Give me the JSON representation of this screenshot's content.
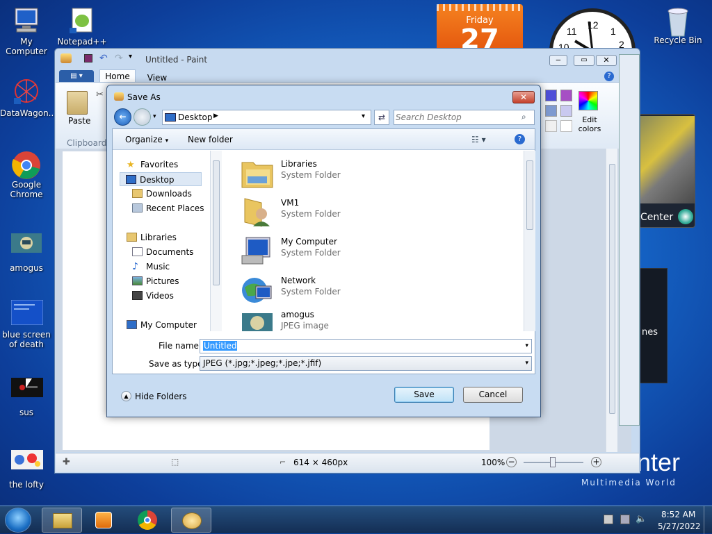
{
  "desktop": {
    "icons": [
      {
        "label": "My Computer"
      },
      {
        "label": "Notepad++"
      },
      {
        "label": "DataWagon..."
      },
      {
        "label": "Google Chrome"
      },
      {
        "label": "amogus"
      },
      {
        "label": "blue screen of death"
      },
      {
        "label": "sus"
      },
      {
        "label": "the lofty"
      },
      {
        "label": "Recycle Bin"
      }
    ],
    "gadget_calendar": {
      "day": "Friday",
      "date": "27"
    },
    "media_center": {
      "text_center": "Center",
      "brand": "nter",
      "tagline": "Multimedia World",
      "side_text": "nes"
    }
  },
  "paint": {
    "title": "Untitled - Paint",
    "tabs": [
      "Home",
      "View"
    ],
    "clipboard": {
      "paste_label": "Paste",
      "group_label": "Clipboard"
    },
    "edit_colors_label": "Edit colors",
    "status": {
      "dimensions": "614 × 460px",
      "zoom": "100%"
    },
    "colors": [
      "#4f4fd8",
      "#a64fc4",
      "#7e9ad0",
      "#c9c9f0",
      "#f0f0f0",
      "#ffffff"
    ]
  },
  "dialog": {
    "title": "Save As",
    "address": "Desktop",
    "search_placeholder": "Search Desktop",
    "toolbar": {
      "organize": "Organize",
      "new_folder": "New folder"
    },
    "nav": {
      "favorites": "Favorites",
      "desktop": "Desktop",
      "downloads": "Downloads",
      "recent_places": "Recent Places",
      "libraries": "Libraries",
      "documents": "Documents",
      "music": "Music",
      "pictures": "Pictures",
      "videos": "Videos",
      "my_computer": "My Computer"
    },
    "files": [
      {
        "name": "Libraries",
        "type": "System Folder"
      },
      {
        "name": "VM1",
        "type": "System Folder"
      },
      {
        "name": "My Computer",
        "type": "System Folder"
      },
      {
        "name": "Network",
        "type": "System Folder"
      },
      {
        "name": "amogus",
        "type": "JPEG image"
      }
    ],
    "file_name_label": "File name:",
    "file_name_value": "Untitled",
    "save_type_label": "Save as type:",
    "save_type_value": "JPEG (*.jpg;*.jpeg;*.jpe;*.jfif)",
    "hide_folders": "Hide Folders",
    "save_button": "Save",
    "cancel_button": "Cancel"
  },
  "taskbar": {
    "time": "8:52 AM",
    "date": "5/27/2022"
  }
}
